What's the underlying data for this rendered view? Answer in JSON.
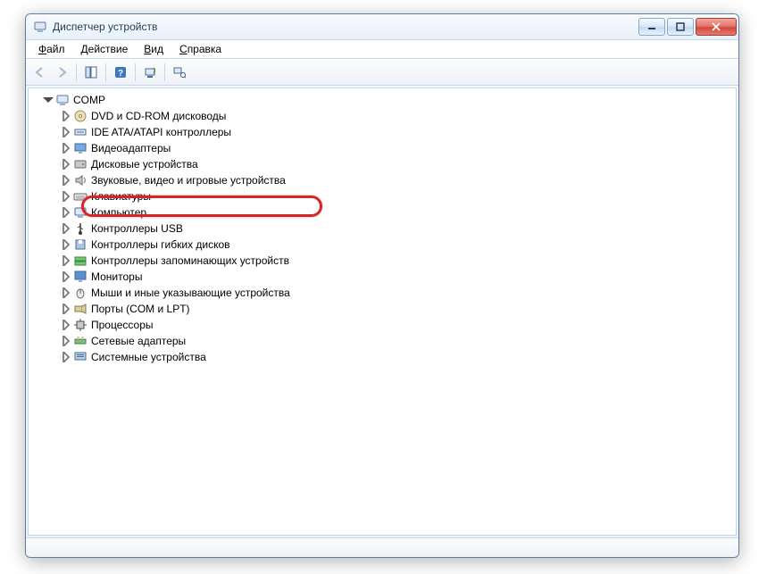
{
  "window": {
    "title": "Диспетчер устройств"
  },
  "menu": {
    "file": {
      "label": "Файл",
      "accel_index": 0
    },
    "action": {
      "label": "Действие",
      "accel_index": 0
    },
    "view": {
      "label": "Вид",
      "accel_index": 0
    },
    "help": {
      "label": "Справка",
      "accel_index": 0
    }
  },
  "tree": {
    "root": {
      "label": "COMP",
      "icon": "computer-icon"
    },
    "items": [
      {
        "label": "DVD и CD-ROM дисководы",
        "icon": "disc-icon"
      },
      {
        "label": "IDE ATA/ATAPI контроллеры",
        "icon": "ide-icon"
      },
      {
        "label": "Видеоадаптеры",
        "icon": "display-adapter-icon"
      },
      {
        "label": "Дисковые устройства",
        "icon": "disk-icon"
      },
      {
        "label": "Звуковые, видео и игровые устройства",
        "icon": "sound-icon",
        "highlighted": true
      },
      {
        "label": "Клавиатуры",
        "icon": "keyboard-icon"
      },
      {
        "label": "Компьютер",
        "icon": "computer-icon"
      },
      {
        "label": "Контроллеры USB",
        "icon": "usb-icon"
      },
      {
        "label": "Контроллеры гибких дисков",
        "icon": "floppy-controller-icon"
      },
      {
        "label": "Контроллеры запоминающих устройств",
        "icon": "storage-controller-icon"
      },
      {
        "label": "Мониторы",
        "icon": "monitor-icon"
      },
      {
        "label": "Мыши и иные указывающие устройства",
        "icon": "mouse-icon"
      },
      {
        "label": "Порты (COM и LPT)",
        "icon": "port-icon"
      },
      {
        "label": "Процессоры",
        "icon": "cpu-icon"
      },
      {
        "label": "Сетевые адаптеры",
        "icon": "network-icon"
      },
      {
        "label": "Системные устройства",
        "icon": "system-icon"
      }
    ]
  }
}
